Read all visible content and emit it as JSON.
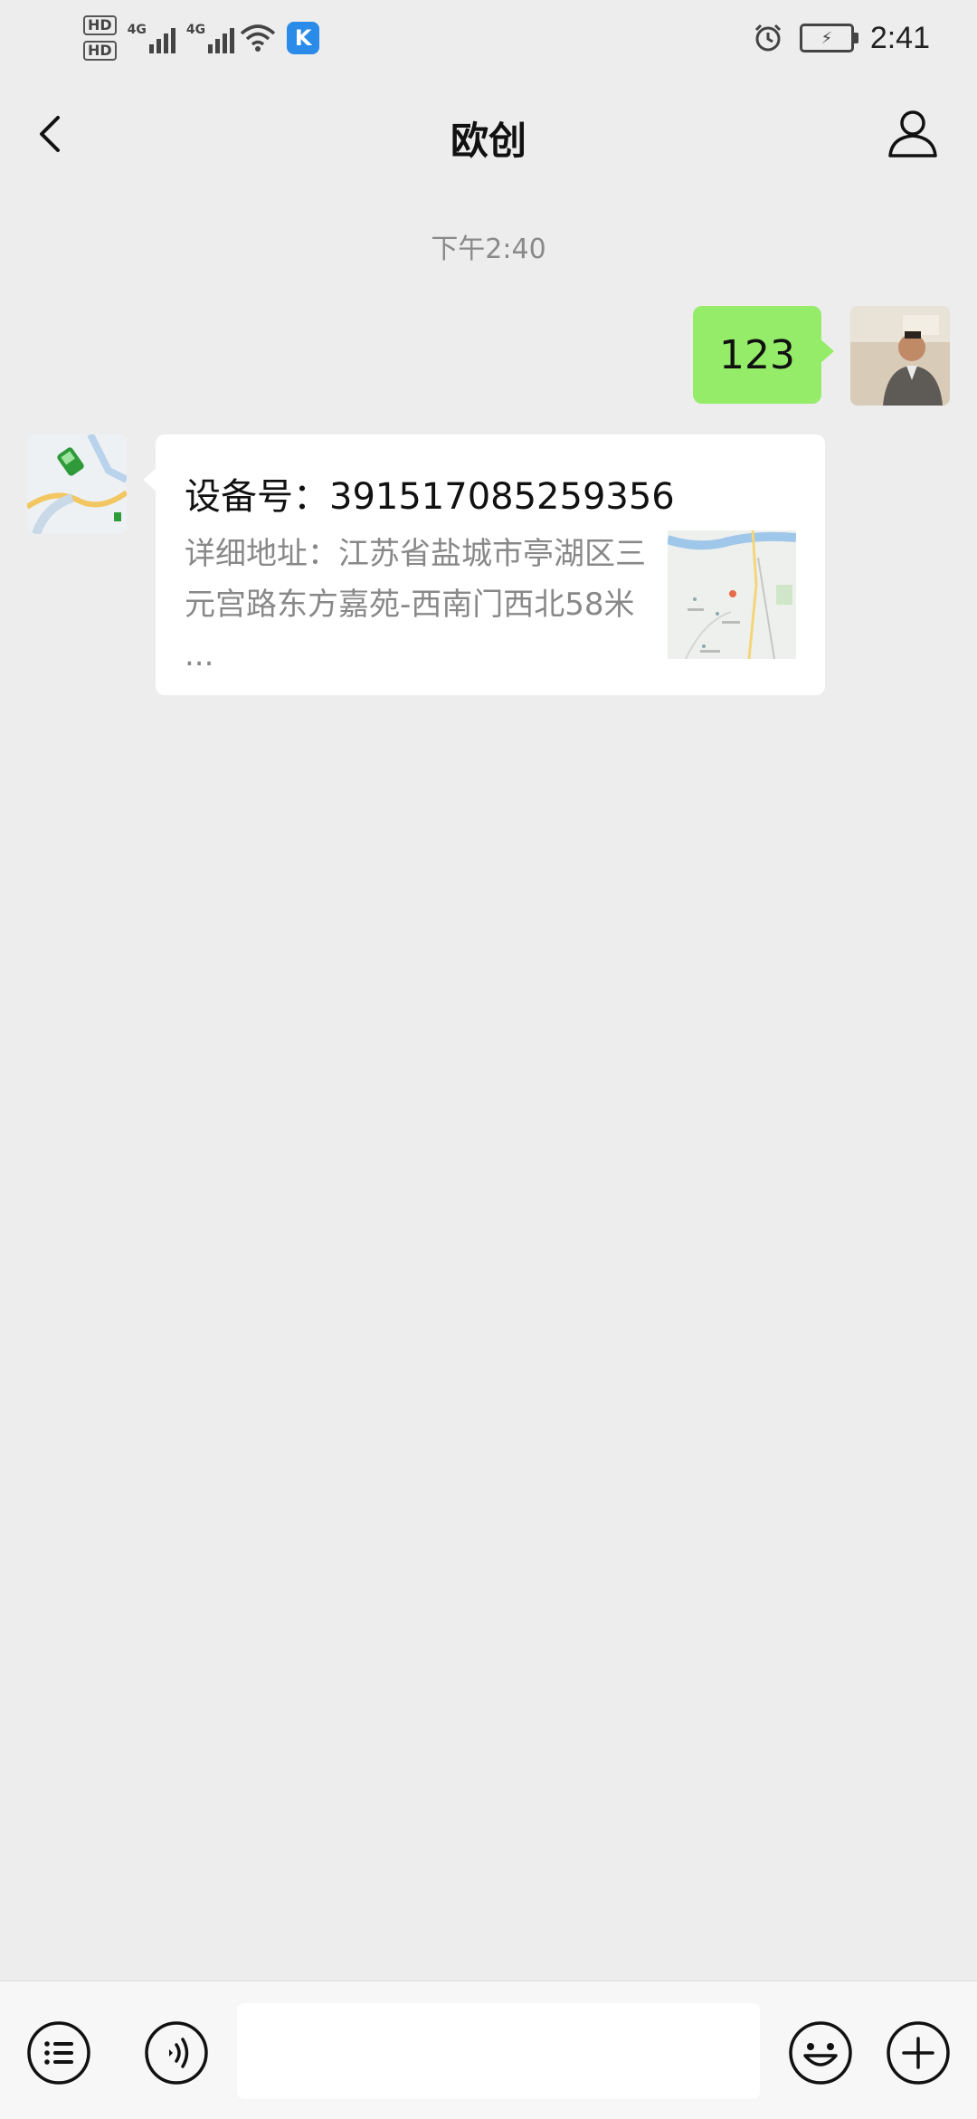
{
  "status_bar": {
    "time": "2:41",
    "sim1": "HD",
    "sim2": "HD",
    "net1": "4G",
    "net2": "4G",
    "app_badge": "K",
    "icons": [
      "alarm-icon",
      "battery-charging-icon",
      "wifi-icon",
      "signal-icon"
    ]
  },
  "header": {
    "title": "欧创",
    "back_icon": "chevron-left-icon",
    "profile_icon": "person-icon"
  },
  "chat": {
    "timestamp": "下午2:40",
    "outgoing_text": "123",
    "card": {
      "title": "设备号：391517085259356",
      "description": "详细地址：江苏省盐城市亭湖区三元宫路东方嘉苑-西南门西北58米 ..."
    }
  },
  "input_bar": {
    "placeholder": "",
    "icons": [
      "menu-list-icon",
      "voice-icon",
      "emoji-icon",
      "plus-icon"
    ]
  },
  "colors": {
    "background": "#ededed",
    "outgoing_bubble": "#95ec69",
    "incoming_bubble": "#ffffff"
  }
}
